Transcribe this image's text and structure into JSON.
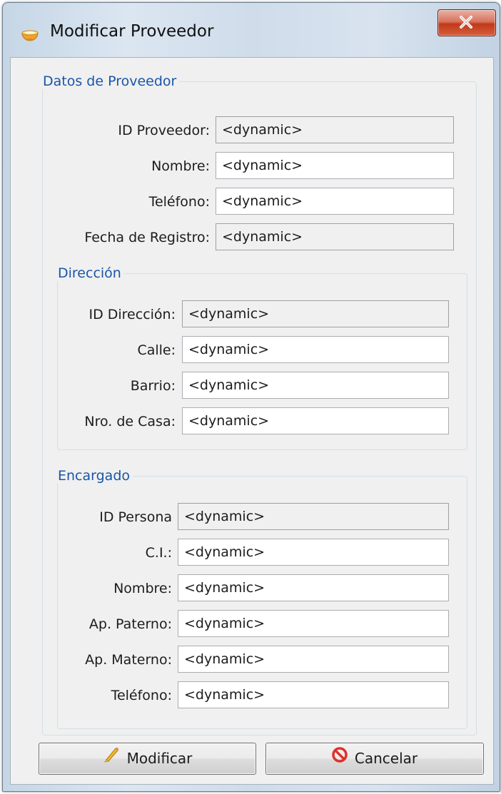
{
  "window": {
    "title": "Modificar Proveedor"
  },
  "datos": {
    "legend": "Datos de Proveedor",
    "fields": [
      {
        "label": "ID Proveedor:",
        "value": "<dynamic>",
        "readonly": true
      },
      {
        "label": "Nombre:",
        "value": "<dynamic>",
        "readonly": false
      },
      {
        "label": "Teléfono:",
        "value": "<dynamic>",
        "readonly": false
      },
      {
        "label": "Fecha de Registro:",
        "value": "<dynamic>",
        "readonly": true
      }
    ]
  },
  "direccion": {
    "legend": "Dirección",
    "fields": [
      {
        "label": "ID Dirección:",
        "value": "<dynamic>",
        "readonly": true
      },
      {
        "label": "Calle:",
        "value": "<dynamic>",
        "readonly": false
      },
      {
        "label": "Barrio:",
        "value": "<dynamic>",
        "readonly": false
      },
      {
        "label": "Nro. de Casa:",
        "value": "<dynamic>",
        "readonly": false
      }
    ]
  },
  "encargado": {
    "legend": "Encargado",
    "fields": [
      {
        "label": "ID Persona",
        "value": "<dynamic>",
        "readonly": true
      },
      {
        "label": "C.I.:",
        "value": "<dynamic>",
        "readonly": false
      },
      {
        "label": "Nombre:",
        "value": "<dynamic>",
        "readonly": false
      },
      {
        "label": "Ap. Paterno:",
        "value": "<dynamic>",
        "readonly": false
      },
      {
        "label": "Ap. Materno:",
        "value": "<dynamic>",
        "readonly": false
      },
      {
        "label": "Teléfono:",
        "value": "<dynamic>",
        "readonly": false
      }
    ]
  },
  "buttons": {
    "modificar": {
      "label": "Modificar",
      "icon": "pencil-icon"
    },
    "cancelar": {
      "label": "Cancelar",
      "icon": "cancel-icon"
    },
    "close": {
      "icon": "close-icon"
    }
  }
}
